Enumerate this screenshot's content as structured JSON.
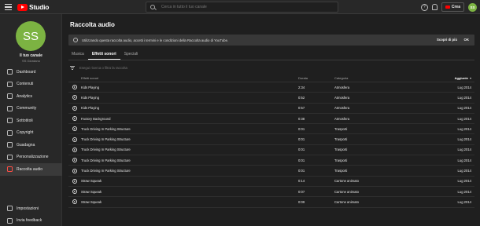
{
  "header": {
    "logo_text": "Studio",
    "search_placeholder": "Cerca in tutto il tuo canale",
    "help_glyph": "?",
    "create_label": "Crea",
    "avatar_initials": "SS"
  },
  "sidebar": {
    "avatar_initials": "SS",
    "channel_title": "Il tuo canale",
    "channel_sub": "SS Giordano",
    "items": [
      {
        "label": "Dashboard",
        "icon": "dashboard-icon"
      },
      {
        "label": "Contenuti",
        "icon": "content-icon"
      },
      {
        "label": "Analytics",
        "icon": "analytics-icon"
      },
      {
        "label": "Community",
        "icon": "community-icon"
      },
      {
        "label": "Sottotitoli",
        "icon": "subtitles-icon"
      },
      {
        "label": "Copyright",
        "icon": "copyright-icon"
      },
      {
        "label": "Guadagna",
        "icon": "earn-icon"
      },
      {
        "label": "Personalizzazione",
        "icon": "customization-icon"
      },
      {
        "label": "Raccolta audio",
        "icon": "audio-library-icon",
        "active": true
      }
    ],
    "bottom_items": [
      {
        "label": "Impostazioni",
        "icon": "settings-icon"
      },
      {
        "label": "Invia feedback",
        "icon": "feedback-icon"
      }
    ]
  },
  "main": {
    "title": "Raccolta audio",
    "banner": {
      "text": "Utilizzando questa raccolta audio, accetti i termini e le condizioni della Raccolta audio di YouTube.",
      "link": "Scopri di più",
      "ok": "OK"
    },
    "tabs": [
      {
        "label": "Musica",
        "active": false
      },
      {
        "label": "Effetti sonori",
        "active": true
      },
      {
        "label": "Speciali",
        "active": false
      }
    ],
    "filter_placeholder": "Esegui ricerca o filtra la raccolta",
    "columns": {
      "name": "Effetti sonori",
      "duration": "Durata",
      "category": "Categoria",
      "added": "Aggiunte"
    },
    "rows": [
      {
        "name": "Kids Playing",
        "duration": "2:34",
        "category": "Atmosfera",
        "added": "Lug 2014"
      },
      {
        "name": "Kids Playing",
        "duration": "0:52",
        "category": "Atmosfera",
        "added": "Lug 2014"
      },
      {
        "name": "Kids Playing",
        "duration": "0:57",
        "category": "Atmosfera",
        "added": "Lug 2014"
      },
      {
        "name": "Factory Background",
        "duration": "0:38",
        "category": "Atmosfera",
        "added": "Lug 2014"
      },
      {
        "name": "Truck Driving In Parking Structure",
        "duration": "0:01",
        "category": "Trasporti",
        "added": "Lug 2014"
      },
      {
        "name": "Truck Driving In Parking Structure",
        "duration": "0:01",
        "category": "Trasporti",
        "added": "Lug 2014"
      },
      {
        "name": "Truck Driving In Parking Structure",
        "duration": "0:01",
        "category": "Trasporti",
        "added": "Lug 2014"
      },
      {
        "name": "Truck Driving In Parking Structure",
        "duration": "0:01",
        "category": "Trasporti",
        "added": "Lug 2014"
      },
      {
        "name": "Truck Driving In Parking Structure",
        "duration": "0:01",
        "category": "Trasporti",
        "added": "Lug 2014"
      },
      {
        "name": "Straw Squeak",
        "duration": "0:14",
        "category": "Cartone animato",
        "added": "Lug 2014"
      },
      {
        "name": "Straw Squeak",
        "duration": "0:07",
        "category": "Cartone animato",
        "added": "Lug 2014"
      },
      {
        "name": "Straw Squeak",
        "duration": "0:09",
        "category": "Cartone animato",
        "added": "Lug 2014"
      }
    ]
  },
  "colors": {
    "brand_red": "#ff0000",
    "avatar_green": "#7cb342",
    "background": "#1f1f1f",
    "panel": "#282828"
  }
}
